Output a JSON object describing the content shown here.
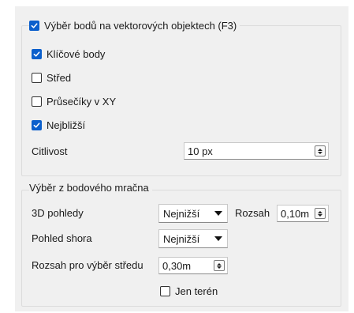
{
  "colors": {
    "panel_bg": "#f0f0f0",
    "accent": "#0b5fcc",
    "group_border": "#dcdcdc"
  },
  "vector": {
    "title": "Výběr bodů na vektorových objektech (F3)",
    "title_checked": true,
    "key_points": {
      "label": "Klíčové body",
      "checked": true
    },
    "center": {
      "label": "Střed",
      "checked": false
    },
    "intersections": {
      "label": "Průsečíky v XY",
      "checked": false
    },
    "nearest": {
      "label": "Nejbližší",
      "checked": true
    },
    "sensitivity": {
      "label": "Citlivost",
      "value": "10 px"
    }
  },
  "cloud": {
    "title": "Výběr z bodového mračna",
    "views_3d": {
      "label": "3D pohledy",
      "value": "Nejnižší"
    },
    "range": {
      "label": "Rozsah",
      "value": "0,10m"
    },
    "top_view": {
      "label": "Pohled shora",
      "value": "Nejnižší"
    },
    "center_range": {
      "label": "Rozsah pro výběr středu",
      "value": "0,30m"
    },
    "terrain_only": {
      "label": "Jen terén",
      "checked": false
    }
  }
}
